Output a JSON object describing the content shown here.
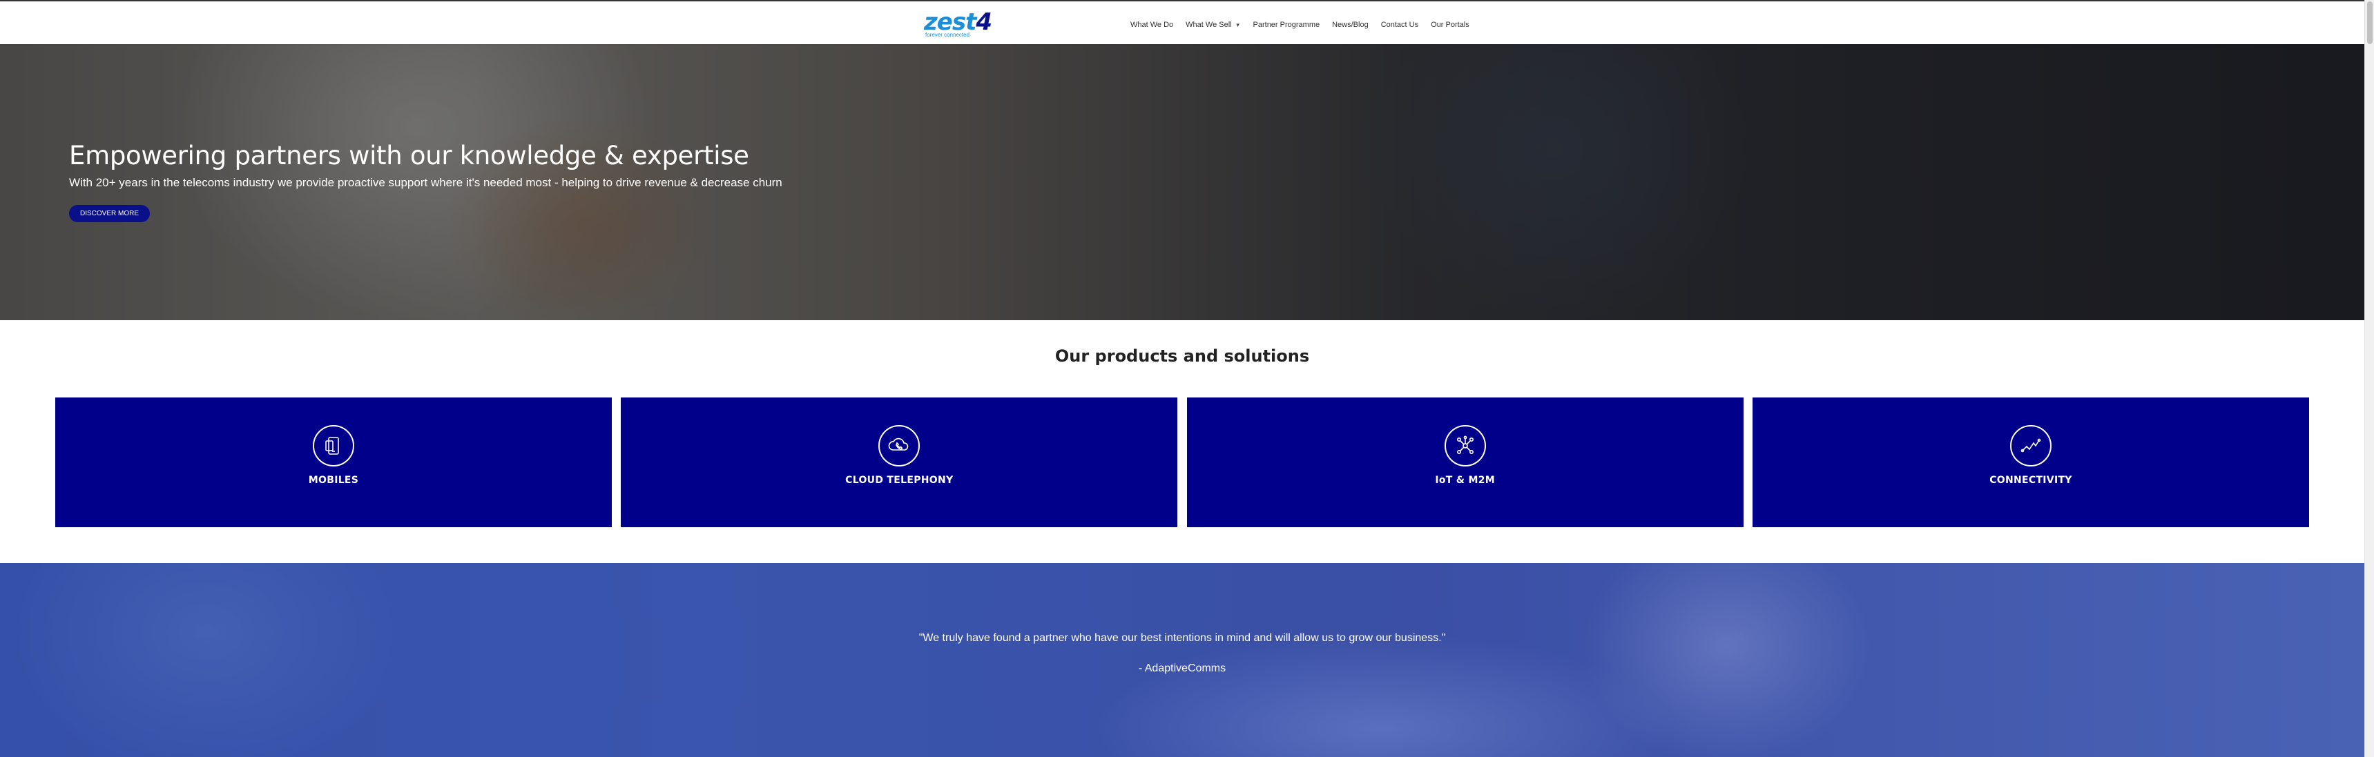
{
  "header": {
    "logo": {
      "text_main": "zest",
      "text_accent": "4",
      "tagline": "forever connected"
    },
    "nav": [
      {
        "label": "What We Do"
      },
      {
        "label": "What We Sell",
        "has_dropdown": true
      },
      {
        "label": "Partner Programme"
      },
      {
        "label": "News/Blog"
      },
      {
        "label": "Contact Us"
      },
      {
        "label": "Our Portals"
      }
    ]
  },
  "hero": {
    "title": "Empowering partners with our knowledge & expertise",
    "subtitle": "With 20+ years in the telecoms industry we provide proactive support where it's needed most - helping to drive revenue & decrease churn",
    "button_label": "DISCOVER MORE"
  },
  "products": {
    "title": "Our products and solutions",
    "items": [
      {
        "label": "MOBILES",
        "icon": "mobile-icon"
      },
      {
        "label": "CLOUD TELEPHONY",
        "icon": "cloud-telephony-icon"
      },
      {
        "label": "IoT & M2M",
        "icon": "iot-network-icon"
      },
      {
        "label": "CONNECTIVITY",
        "icon": "connectivity-icon"
      }
    ]
  },
  "testimonial": {
    "quote": "\"We truly have found a partner who have our best intentions in mind and will allow us to grow our business.\"",
    "author": "- AdaptiveComms"
  },
  "colors": {
    "brand_blue": "#00008b",
    "logo_blue": "#1a8ed8",
    "testimonial_bg": "#3a55ad"
  }
}
